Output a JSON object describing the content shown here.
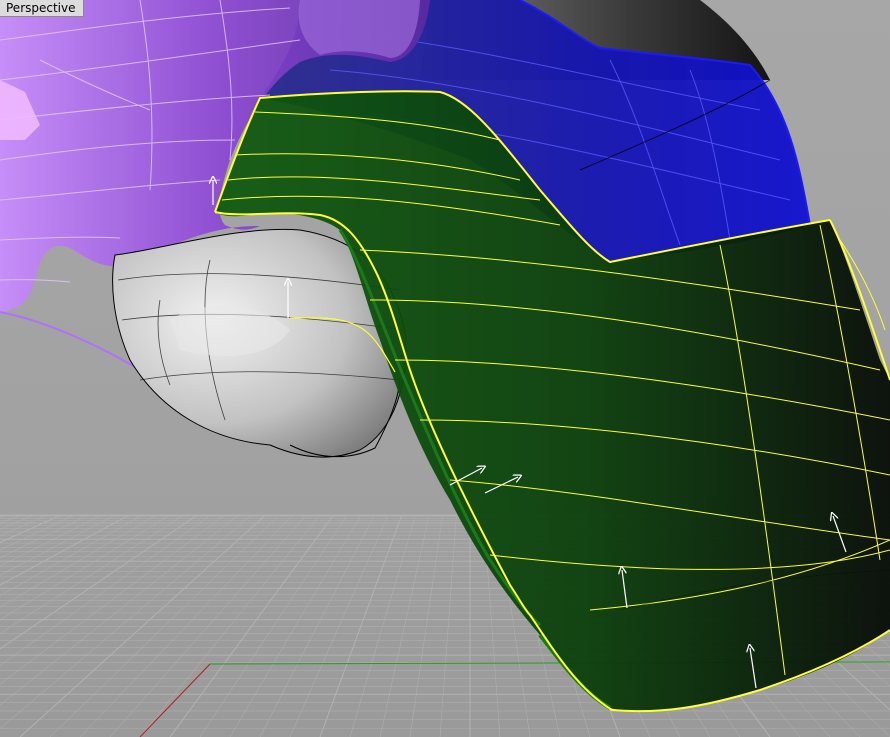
{
  "viewport": {
    "title": "Perspective",
    "projection": "perspective"
  },
  "colors": {
    "background": "#a3a3a3",
    "grid_line": "#b2b2b2",
    "x_axis": "#b02020",
    "y_axis": "#1fa01f",
    "selection_highlight": "#ffff33",
    "green_surface": "#0c4a0c",
    "blue_surface": "#1a1aa0",
    "purple_surface": "#a45ce8",
    "white_surface": "#d6d6d6",
    "dark_surface": "#1e1e1e",
    "normal_arrow": "#ffffff"
  },
  "objects": [
    {
      "name": "purple-surface",
      "color_key": "purple_surface",
      "state": "unselected"
    },
    {
      "name": "blue-surface",
      "color_key": "blue_surface",
      "state": "unselected"
    },
    {
      "name": "dark-top-surface",
      "color_key": "dark_surface",
      "state": "unselected"
    },
    {
      "name": "white-rounded-surface",
      "color_key": "white_surface",
      "state": "unselected"
    },
    {
      "name": "green-selected-surface",
      "color_key": "green_surface",
      "state": "selected"
    }
  ],
  "normals_visible": true
}
